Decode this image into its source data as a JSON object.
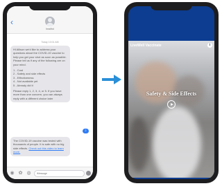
{
  "left_phone": {
    "header": {
      "back_icon": "chevron-left-icon",
      "contact_name": "healthd"
    },
    "timestamp": "Today 10:01 AM",
    "incoming_message_1": {
      "intro": "Hi Allison we'd like to address your questions about the COVID-19 vaccine to help you get your shot as soon as possible. Please tell us if any of the following are on your mind.",
      "options": [
        "1 - Cost",
        "2 - Safety and side effects",
        "3 - Effectiveness",
        "4 - Not available yet",
        "5 - Already did it"
      ],
      "outro": "Please reply 1, 2, 3, 4, or 5. If you have more than one concern, you can always reply with a different choice later"
    },
    "outgoing_message": "2",
    "incoming_message_2": {
      "text": "The COVID-19 vaccine was tested with thousands of people. It is safe with no big side effects.",
      "link": "Check out this video to learn more."
    },
    "input_bar": {
      "placeholder": "iMessage",
      "icons": [
        "camera-icon",
        "apps-icon",
        "audio-icon",
        "microphone-icon"
      ]
    }
  },
  "arrow": {
    "color": "#2a8fd8",
    "icon": "right-arrow-icon"
  },
  "right_phone": {
    "video_title": "LiveWell Vaccinate",
    "info_icon": "info-icon",
    "video_heading": "Safety & Side Effects",
    "play_icon": "play-icon",
    "background_color": "#0d3d91"
  }
}
